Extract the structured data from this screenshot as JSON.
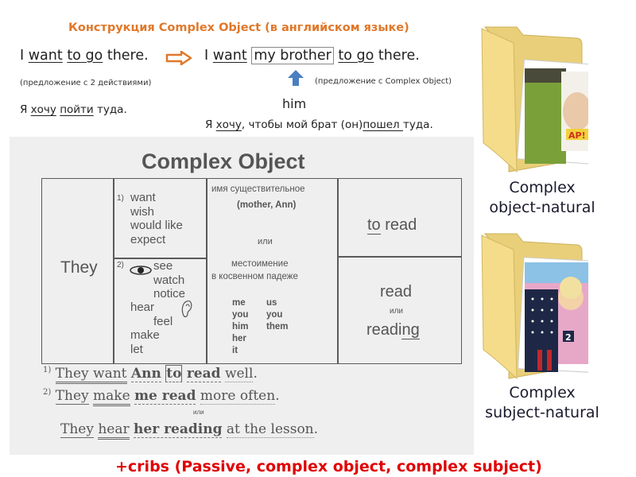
{
  "slide": {
    "title": "Конструкция Complex Object (в английском языке)",
    "example_simple": {
      "parts": [
        "I ",
        "want",
        " ",
        "to go",
        " there."
      ],
      "note": "(предложение с 2 действиями)",
      "translation_parts": [
        "Я ",
        "хочу",
        " ",
        "пойти",
        " туда."
      ]
    },
    "arrow_icon": "right-arrow-icon",
    "example_complex": {
      "parts": [
        "I ",
        "want",
        " ",
        "my brother",
        " ",
        "to go",
        " there."
      ],
      "note": "(предложение с Complex Object)",
      "pronoun_hint": "him",
      "translation_parts": [
        "Я ",
        "хочу",
        ", чтобы мой брат (он)",
        "пошел ",
        "туда."
      ]
    },
    "up_arrow_icon": "up-arrow-icon"
  },
  "textbook": {
    "title": "Complex Object",
    "subject": "They",
    "verbs_group1": {
      "num": "1)",
      "items": [
        "want",
        "wish",
        "would like",
        "expect"
      ]
    },
    "verbs_group2": {
      "num": "2)",
      "eye_icon": "eye-icon",
      "ear_icon": "ear-icon",
      "items": [
        "see",
        "watch",
        "notice",
        "hear",
        "feel",
        "make",
        "let"
      ]
    },
    "object_noun": {
      "label": "имя существительное",
      "examples": "(mother, Ann)"
    },
    "or_word": "или",
    "object_pronoun": {
      "label_line1": "местоимение",
      "label_line2": "в косвенном падеже",
      "col1": [
        "me",
        "you",
        "him",
        "her",
        "it"
      ],
      "col2": [
        "us",
        "you",
        "them"
      ]
    },
    "infinitive": {
      "to": "to",
      "read": " read"
    },
    "bare": {
      "read": "read",
      "or": "или",
      "reading_base": "readi",
      "reading_ng": "ng"
    },
    "examples": [
      {
        "num": "1)",
        "parts": [
          "They want",
          " ",
          "Ann",
          " ",
          "to",
          " ",
          "read",
          " ",
          "well",
          "."
        ]
      },
      {
        "num": "2)",
        "parts": [
          "They",
          " ",
          "make",
          " ",
          "me read",
          " ",
          "more often",
          "."
        ]
      },
      {
        "or": "или"
      },
      {
        "parts": [
          "They",
          " ",
          "hear",
          " ",
          "her reading",
          " ",
          "at the lesson",
          "."
        ]
      }
    ]
  },
  "folders": [
    {
      "icon": "folder-icon",
      "label_line1": "Complex",
      "label_line2": "object-natural"
    },
    {
      "icon": "folder-icon",
      "label_line1": "Complex",
      "label_line2": "subject-natural"
    }
  ],
  "footer": {
    "text": "+cribs (Passive, complex object, complex subject)"
  },
  "colors": {
    "title_orange": "#e0782a",
    "arrow_blue": "#4a7fc0",
    "cribs_red": "#e00000",
    "folder_yellow": "#f2d77e"
  }
}
